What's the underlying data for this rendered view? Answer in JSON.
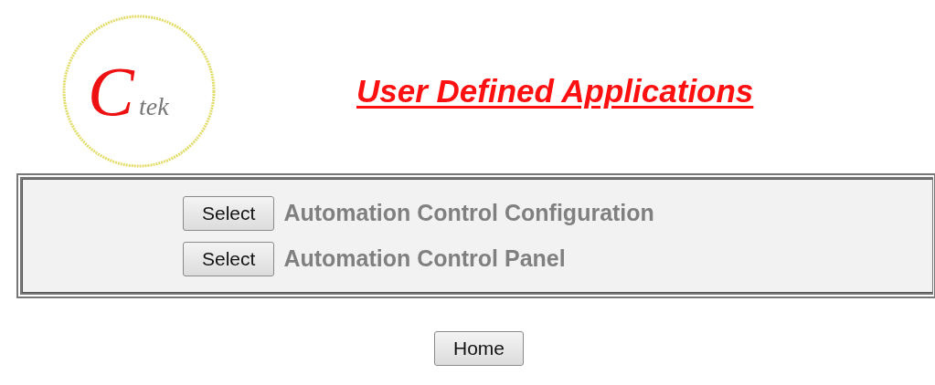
{
  "logo": {
    "initial": "C",
    "rest": "tek"
  },
  "title": "User Defined Applications",
  "applications": [
    {
      "button": "Select",
      "name": "Automation Control Configuration"
    },
    {
      "button": "Select",
      "name": "Automation Control Panel"
    }
  ],
  "home_button": "Home"
}
